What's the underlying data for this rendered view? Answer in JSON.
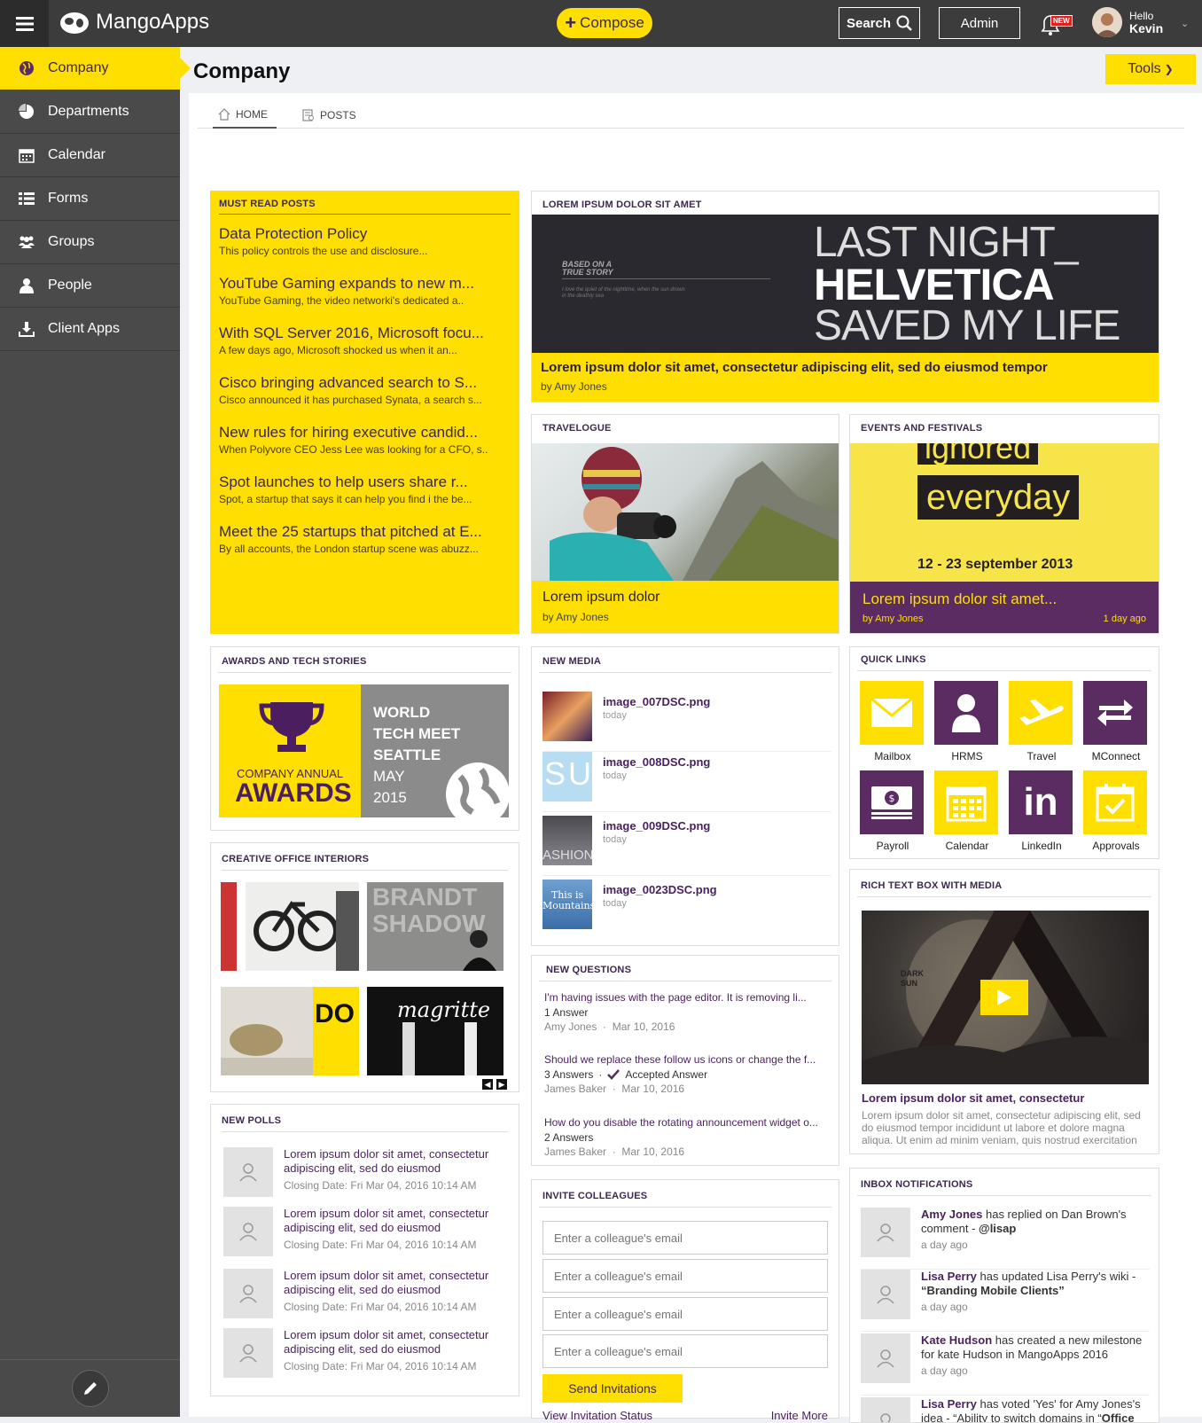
{
  "topbar": {
    "logo_text": "MangoApps",
    "compose_label": "Compose",
    "search_label": "Search",
    "admin_label": "Admin",
    "new_badge": "NEW",
    "hello": "Hello",
    "user_name": "Kevin"
  },
  "sidebar": {
    "items": [
      {
        "label": "Company",
        "icon": "globe-icon"
      },
      {
        "label": "Departments",
        "icon": "pie-icon"
      },
      {
        "label": "Calendar",
        "icon": "calendar-icon"
      },
      {
        "label": "Forms",
        "icon": "list-icon"
      },
      {
        "label": "Groups",
        "icon": "groups-icon"
      },
      {
        "label": "People",
        "icon": "person-icon"
      },
      {
        "label": "Client Apps",
        "icon": "download-icon"
      }
    ]
  },
  "page": {
    "title": "Company",
    "tools_label": "Tools",
    "tabs": [
      {
        "label": "HOME"
      },
      {
        "label": "POSTS"
      }
    ]
  },
  "must_read": {
    "heading": "MUST READ POSTS",
    "items": [
      {
        "title": "Data Protection Policy",
        "sub": "This policy controls the use and disclosure..."
      },
      {
        "title": "YouTube Gaming expands to new m...",
        "sub": "YouTube Gaming, the video networki's dedicated a.."
      },
      {
        "title": "With SQL Server 2016, Microsoft focu...",
        "sub": "A few days ago, Microsoft shocked us when it an..."
      },
      {
        "title": "Cisco bringing advanced search to S...",
        "sub": "Cisco announced it has purchased Synata, a search s..."
      },
      {
        "title": "New rules for hiring executive candid...",
        "sub": "When Polyvore CEO Jess Lee was looking for a CFO, s.."
      },
      {
        "title": "Spot launches to help users share r...",
        "sub": "Spot, a startup that says it can help you find i the be..."
      },
      {
        "title": "Meet the 25 startups that pitched at E...",
        "sub": "By all accounts, the London startup scene was abuzz..."
      }
    ]
  },
  "lorem_card": {
    "heading": "LOREM IPSUM DOLOR SIT AMET",
    "banner_line1": "LAST NIGHT_",
    "banner_line2": "HELVETICA",
    "banner_line3": "SAVED MY LIFE",
    "banner_small": "BASED ON A TRUE STORY",
    "banner_tiny": "I love the quiet of the nighttime, when the sun drown in the deathly sea",
    "title": "Lorem ipsum dolor sit amet, consectetur adipiscing elit, sed do eiusmod tempor",
    "by": "by Amy Jones"
  },
  "travelogue": {
    "heading": "TRAVELOGUE",
    "title": "Lorem ipsum dolor",
    "by": "by Amy Jones"
  },
  "events": {
    "heading": "EVENTS AND FESTIVALS",
    "word1": "ignored",
    "word2": "everyday",
    "date": "12 - 23 september 2013",
    "title": "Lorem ipsum dolor sit amet...",
    "by": "by Amy Jones",
    "time": "1 day ago"
  },
  "awards": {
    "heading": "AWARDS AND TECH STORIES",
    "left_small": "COMPANY ANNUAL",
    "left_big": "AWARDS",
    "right_l1": "WORLD",
    "right_l2": "TECH MEET",
    "right_l3": "SEATTLE",
    "right_l4": "MAY",
    "right_l5": "2015"
  },
  "creative": {
    "heading": "CREATIVE OFFICE INTERIORS",
    "img2_text": "BRANDT SHADOW",
    "img3_text": "DO",
    "img4_text": "magritte"
  },
  "polls": {
    "heading": "NEW POLLS",
    "items": [
      {
        "title": "Lorem ipsum dolor sit amet, consectetur adipiscing elit, sed do eiusmod",
        "date": "Closing Date: Fri Mar 04, 2016 10:14 AM"
      },
      {
        "title": "Lorem ipsum dolor sit amet, consectetur adipiscing elit, sed do eiusmod",
        "date": "Closing Date: Fri Mar 04, 2016 10:14 AM"
      },
      {
        "title": "Lorem ipsum dolor sit amet, consectetur adipiscing elit, sed do eiusmod",
        "date": "Closing Date: Fri Mar 04, 2016 10:14 AM"
      },
      {
        "title": "Lorem ipsum dolor sit amet, consectetur adipiscing elit, sed do eiusmod",
        "date": "Closing Date: Fri Mar 04, 2016 10:14 AM"
      }
    ]
  },
  "new_media": {
    "heading": "NEW MEDIA",
    "items": [
      {
        "name": "image_007DSC.png",
        "date": "today"
      },
      {
        "name": "image_008DSC.png",
        "date": "today",
        "thumb_text": "SU"
      },
      {
        "name": "image_009DSC.png",
        "date": "today",
        "thumb_text": "ASHION"
      },
      {
        "name": "image_0023DSC.png",
        "date": "today",
        "thumb_text": "This is Mountains"
      }
    ]
  },
  "questions": {
    "heading": "NEW QUESTIONS",
    "items": [
      {
        "q": "I'm having issues with the page editor. It is removing li...",
        "answers": "1 Answer",
        "accepted": "",
        "author": "Amy Jones",
        "date": "Mar 10, 2016"
      },
      {
        "q": "Should we replace these follow us icons or change the f...",
        "answers": "3 Answers",
        "accepted": "Accepted Answer",
        "author": "James Baker",
        "date": "Mar 10, 2016"
      },
      {
        "q": "How do you disable the rotating announcement widget o...",
        "answers": "2 Answers",
        "accepted": "",
        "author": "James Baker",
        "date": "Mar 10, 2016"
      }
    ]
  },
  "invite": {
    "heading": "INVITE COLLEAGUES",
    "placeholder": "Enter a colleague's email",
    "send_label": "Send Invitations",
    "status_link": "View Invitation Status",
    "more_link": "Invite More"
  },
  "quick_links": {
    "heading": "QUICK LINKS",
    "items": [
      {
        "label": "Mailbox",
        "icon": "mail-icon",
        "color": "#ffdf00"
      },
      {
        "label": "HRMS",
        "icon": "person-icon",
        "color": "#5a2c62"
      },
      {
        "label": "Travel",
        "icon": "plane-icon",
        "color": "#ffdf00"
      },
      {
        "label": "MConnect",
        "icon": "swap-icon",
        "color": "#5a2c62"
      },
      {
        "label": "Payroll",
        "icon": "money-icon",
        "color": "#5a2c62"
      },
      {
        "label": "Calendar",
        "icon": "calendar-icon",
        "color": "#ffdf00"
      },
      {
        "label": "LinkedIn",
        "icon": "linkedin-icon",
        "color": "#5a2c62",
        "text": "in"
      },
      {
        "label": "Approvals",
        "icon": "approvals-icon",
        "color": "#ffdf00"
      }
    ]
  },
  "rich_text": {
    "heading": "RICH TEXT BOX WITH MEDIA",
    "video_text": "DARK SUN",
    "title": "Lorem ipsum dolor sit amet, consectetur",
    "body": "Lorem ipsum dolor sit amet, consectetur adipiscing elit, sed do eiusmod tempor incididunt ut labore et dolore magna aliqua. Ut enim ad minim veniam, quis nostrud exercitation"
  },
  "inbox": {
    "heading": "INBOX NOTIFICATIONS",
    "items": [
      {
        "name": "Amy Jones",
        "text": " has replied on Dan Brown's comment - ",
        "bold2": "@lisap",
        "time": "a day ago"
      },
      {
        "name": "Lisa Perry",
        "text": " has updated Lisa Perry's wiki - ",
        "bold2": "“Branding Mobile Clients”",
        "time": "a day ago"
      },
      {
        "name": "Kate Hudson",
        "text": " has created a new milestone for kate Hudson in MangoApps 2016",
        "bold2": "",
        "time": "a day ago"
      },
      {
        "name": "Lisa Perry",
        "text": " has voted 'Yes' for Amy Jones's idea - “Ability to switch domains in “",
        "bold2": "Office",
        "time": ""
      }
    ]
  },
  "colors": {
    "accent": "#ffdf00",
    "brand_purple": "#5a2c62",
    "topbar": "#3c3c3c",
    "sidebar": "#4a4a4a"
  }
}
